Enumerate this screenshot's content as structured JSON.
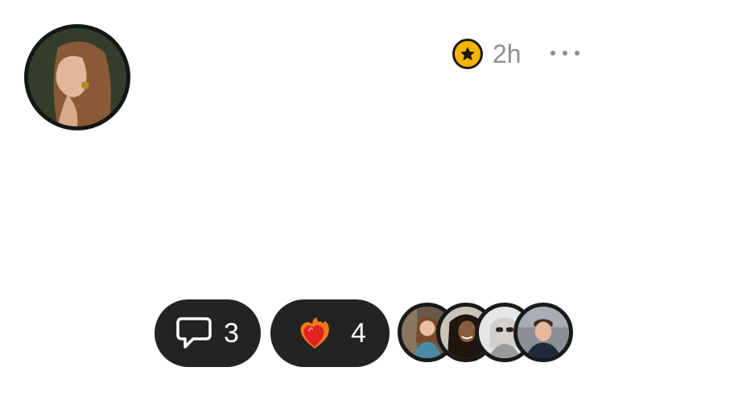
{
  "post": {
    "author": {
      "avatar_icon": "user-avatar"
    },
    "meta": {
      "badge_icon": "star-icon",
      "badge_color": "#f5b400",
      "time_ago": "2h",
      "more_icon": "more-horizontal-icon"
    },
    "actions": {
      "comments": {
        "icon": "comment-icon",
        "count": "3"
      },
      "reactions": {
        "icon": "fire-heart-emoji",
        "count": "4"
      }
    },
    "reactors": [
      {
        "name": "reactor-1"
      },
      {
        "name": "reactor-2"
      },
      {
        "name": "reactor-3"
      },
      {
        "name": "reactor-4"
      }
    ]
  }
}
